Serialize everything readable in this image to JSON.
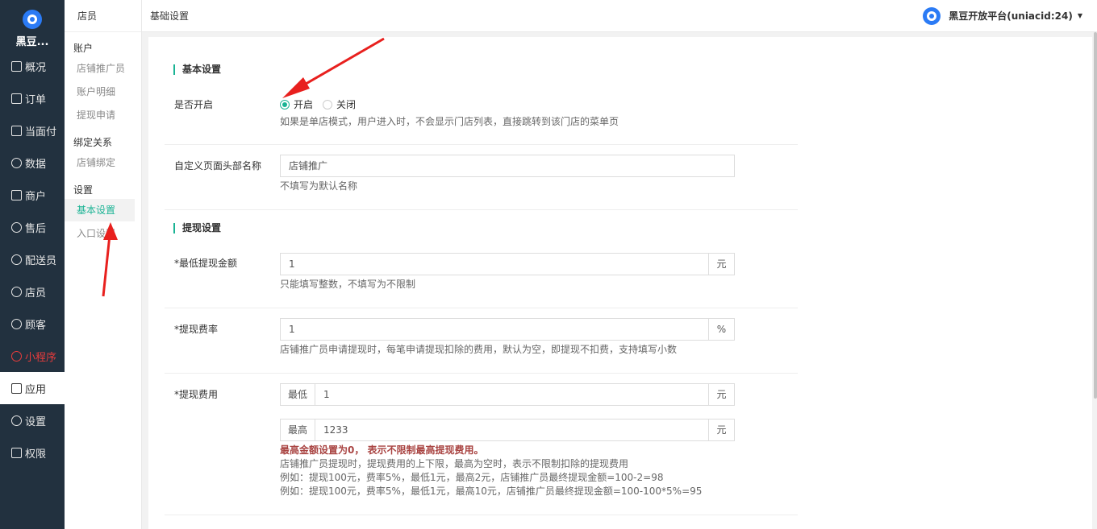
{
  "app": {
    "name": "黑豆...",
    "logo_icon": "mascot-logo-icon"
  },
  "nav": [
    {
      "label": "概况",
      "icon": "overview-icon"
    },
    {
      "label": "订单",
      "icon": "order-icon"
    },
    {
      "label": "当面付",
      "icon": "pay-icon"
    },
    {
      "label": "数据",
      "icon": "data-icon"
    },
    {
      "label": "商户",
      "icon": "merchant-icon"
    },
    {
      "label": "售后",
      "icon": "aftersale-icon"
    },
    {
      "label": "配送员",
      "icon": "courier-icon"
    },
    {
      "label": "店员",
      "icon": "clerk-icon"
    },
    {
      "label": "顾客",
      "icon": "customer-icon"
    },
    {
      "label": "小程序",
      "icon": "miniapp-icon"
    },
    {
      "label": "应用",
      "icon": "apps-icon"
    },
    {
      "label": "设置",
      "icon": "gear-icon"
    },
    {
      "label": "权限",
      "icon": "lock-icon"
    }
  ],
  "submenu": {
    "title": "店员",
    "groups": [
      {
        "label": "账户",
        "items": [
          "店铺推广员",
          "账户明细",
          "提现申请"
        ]
      },
      {
        "label": "绑定关系",
        "items": [
          "店铺绑定"
        ]
      },
      {
        "label": "设置",
        "items": [
          "基本设置",
          "入口设置"
        ]
      }
    ]
  },
  "topbar": {
    "breadcrumb": "基础设置",
    "account": "黑豆开放平台(uniacid:24)"
  },
  "form": {
    "basic_section": "基本设置",
    "enable": {
      "label": "是否开启",
      "on": "开启",
      "off": "关闭",
      "selected": "开启",
      "help": "如果是单店模式，用户进入时，不会显示门店列表，直接跳转到该门店的菜单页"
    },
    "header_name": {
      "label": "自定义页面头部名称",
      "value": "店铺推广",
      "help": "不填写为默认名称"
    },
    "withdraw_section": "提现设置",
    "min_amount": {
      "label": "*最低提现金额",
      "value": "1",
      "unit": "元",
      "help": "只能填写整数，不填写为不限制"
    },
    "fee_rate": {
      "label": "*提现费率",
      "value": "1",
      "unit": "%",
      "help": "店铺推广员申请提现时，每笔申请提现扣除的费用，默认为空，即提现不扣费，支持填写小数"
    },
    "fee": {
      "label": "*提现费用",
      "min_label": "最低",
      "min_value": "1",
      "min_unit": "元",
      "max_label": "最高",
      "max_value": "1233",
      "max_unit": "元",
      "warning": "最高金额设置为0， 表示不限制最高提现费用。",
      "help1": "店铺推广员提现时，提现费用的上下限，最高为空时，表示不限制扣除的提现费用",
      "help2": "例如：提现100元，费率5%，最低1元，最高2元，店铺推广员最终提现金额=100-2=98",
      "help3": "例如：提现100元，费率5%，最低1元，最高10元，店铺推广员最终提现金额=100-100*5%=95"
    }
  },
  "colors": {
    "sidebar": "#22313f",
    "accent": "#1ab394",
    "arrow": "#e8201e",
    "warn": "#a94442"
  }
}
